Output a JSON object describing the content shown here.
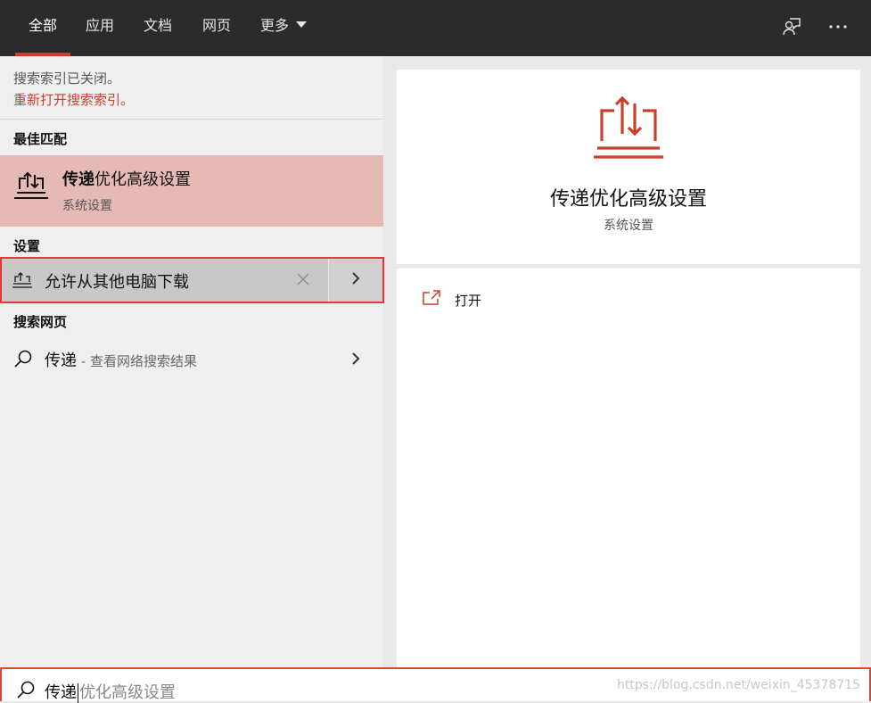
{
  "tabs": [
    {
      "label": "全部",
      "active": true
    },
    {
      "label": "应用",
      "active": false
    },
    {
      "label": "文档",
      "active": false
    },
    {
      "label": "网页",
      "active": false
    },
    {
      "label": "更多",
      "active": false,
      "has_dropdown": true
    }
  ],
  "topbar_icons": [
    "feedback-icon",
    "more-icon"
  ],
  "notice": {
    "line1": "搜索索引已关闭。",
    "link": "重新打开搜索索引。"
  },
  "sections": {
    "best_match": "最佳匹配",
    "settings": "设置",
    "web": "搜索网页"
  },
  "best_match": {
    "title_bold": "传递",
    "title_rest": "优化高级设置",
    "subtitle": "系统设置",
    "icon": "delivery-optimization-icon"
  },
  "settings_result": {
    "label": "允许从其他电脑下载",
    "icon": "laptop-upload-icon"
  },
  "web_result": {
    "query": "传递",
    "suffix": " - 查看网络搜索结果",
    "icon": "search-icon"
  },
  "detail": {
    "title": "传递优化高级设置",
    "subtitle": "系统设置",
    "action_label": "打开",
    "icon": "delivery-optimization-icon"
  },
  "search": {
    "typed": "传递",
    "completion": "优化高级设置"
  },
  "watermark": "https://blog.csdn.net/weixin_45378715",
  "colors": {
    "accent": "#c8402a",
    "highlight": "#e5bab4",
    "topbar": "#2b2b2b",
    "selection_outline": "#e03a3a"
  }
}
